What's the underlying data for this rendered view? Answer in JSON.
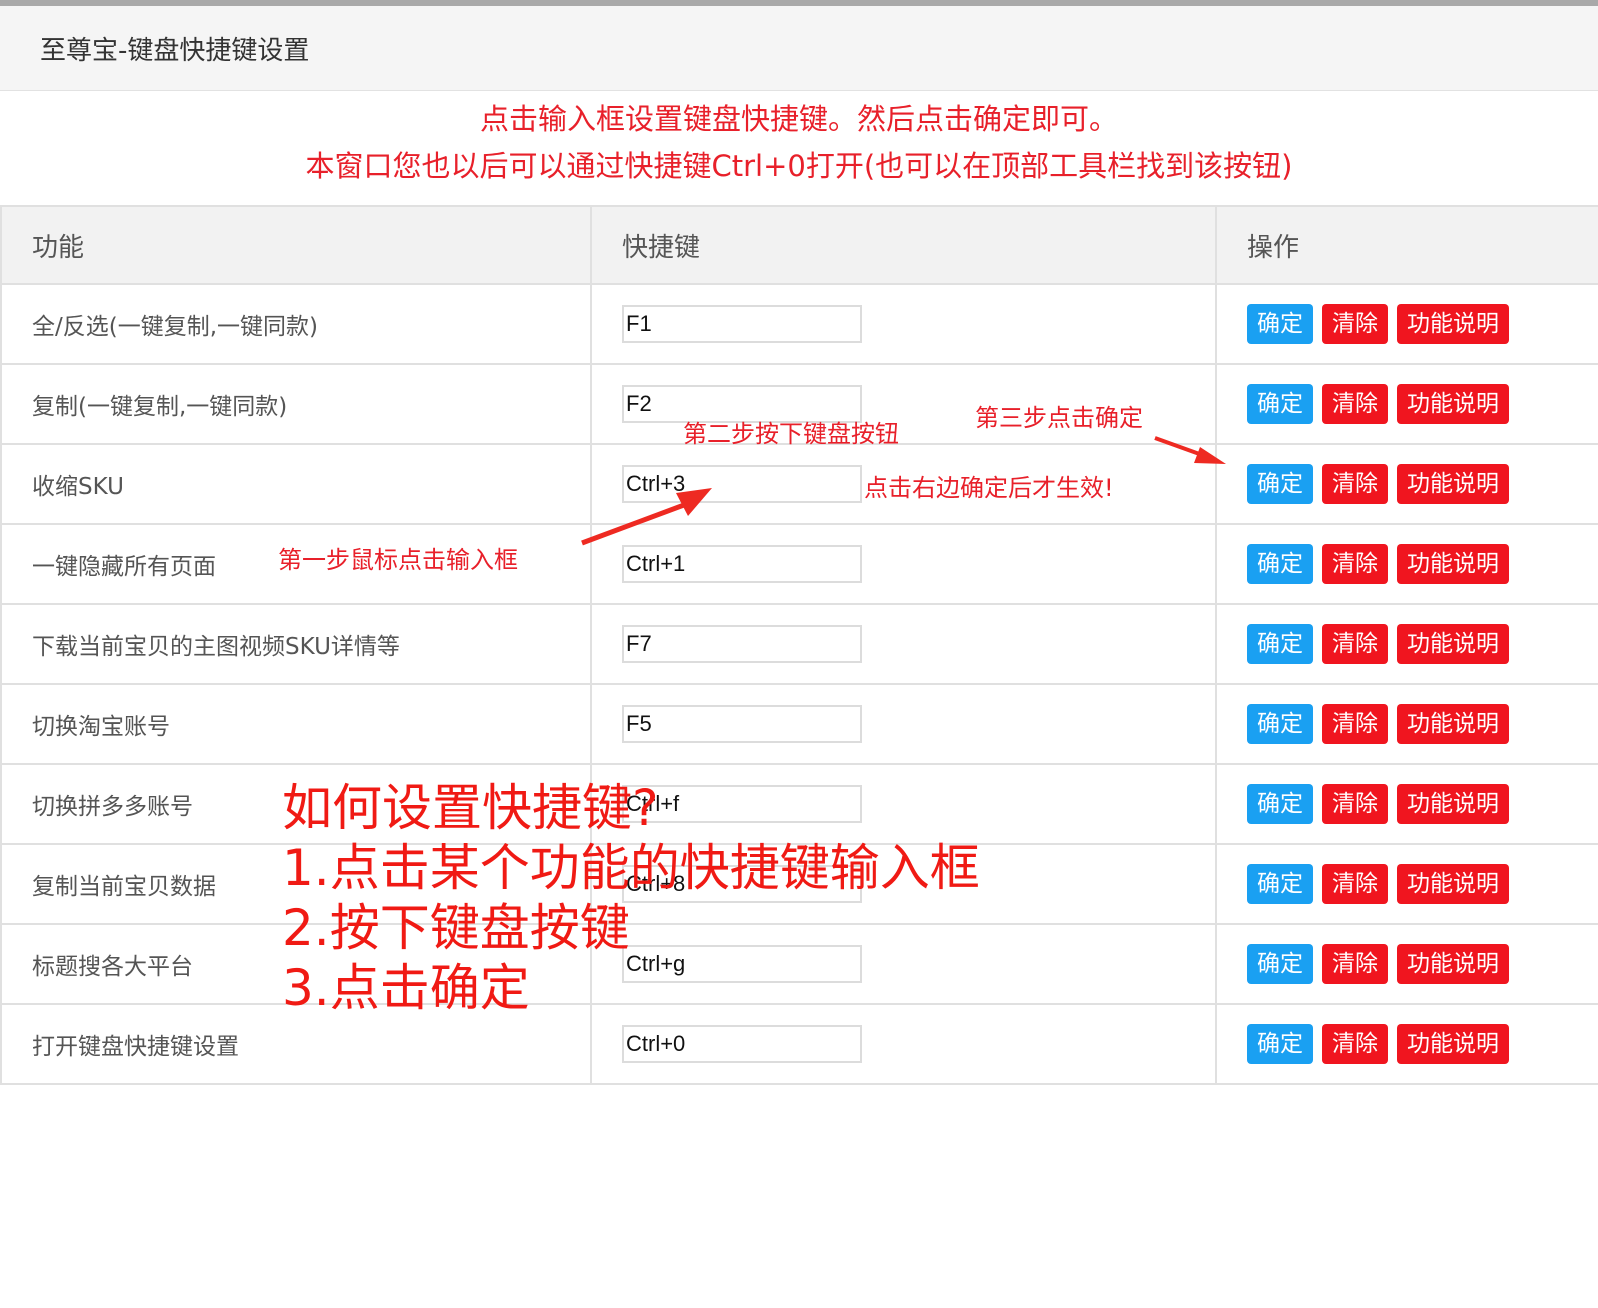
{
  "window": {
    "title": "至尊宝-键盘快捷键设置"
  },
  "notice": {
    "line1": "点击输入框设置键盘快捷键。然后点击确定即可。",
    "line2": "本窗口您也以后可以通过快捷键Ctrl+0打开(也可以在顶部工具栏找到该按钮)"
  },
  "table": {
    "headers": {
      "function": "功能",
      "shortcut": "快捷键",
      "actions": "操作"
    },
    "rows": [
      {
        "function": "全/反选(一键复制,一键同款)",
        "shortcut": "F1"
      },
      {
        "function": "复制(一键复制,一键同款)",
        "shortcut": "F2"
      },
      {
        "function": "收缩SKU",
        "shortcut": "Ctrl+3"
      },
      {
        "function": "一键隐藏所有页面",
        "shortcut": "Ctrl+1"
      },
      {
        "function": "下载当前宝贝的主图视频SKU详情等",
        "shortcut": "F7"
      },
      {
        "function": "切换淘宝账号",
        "shortcut": "F5"
      },
      {
        "function": "切换拼多多账号",
        "shortcut": "Ctrl+f"
      },
      {
        "function": "复制当前宝贝数据",
        "shortcut": "Ctrl+8"
      },
      {
        "function": "标题搜各大平台",
        "shortcut": "Ctrl+g"
      },
      {
        "function": "打开键盘快捷键设置",
        "shortcut": "Ctrl+0"
      }
    ],
    "buttons": {
      "confirm": "确定",
      "clear": "清除",
      "description": "功能说明"
    }
  },
  "annotations": {
    "step1": "第一步鼠标点击输入框",
    "step2": "第二步按下键盘按钮",
    "step3": "第三步点击确定",
    "note": "点击右边确定后才生效!",
    "howto": [
      "如何设置快捷键?",
      "1.点击某个功能的快捷键输入框",
      "2.按下键盘按键",
      "3.点击确定"
    ]
  },
  "colors": {
    "confirm_button": "#1aa0f2",
    "danger_button": "#f0151f",
    "annotation_red": "#e8202a",
    "header_bg": "#f2f2f2",
    "titlebar_bg": "#f5f5f5"
  }
}
